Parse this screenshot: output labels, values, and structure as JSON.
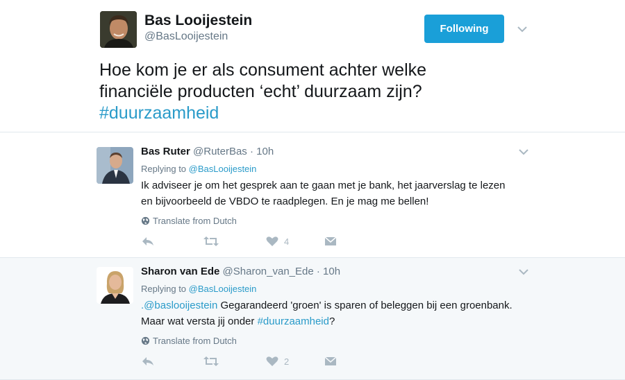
{
  "main_tweet": {
    "author_name": "Bas Looijestein",
    "author_handle": "@BasLooijestein",
    "follow_label": "Following",
    "text_line1": "Hoe kom je er als consument achter welke",
    "text_line2": "financiële producten ‘echt’ duurzaam zijn?",
    "hashtag": "#duurzaamheid"
  },
  "replies": [
    {
      "name": "Bas Ruter",
      "handle": "@RuterBas",
      "time": "· 10h",
      "replying_prefix": "Replying to ",
      "replying_to": "@BasLooijestein",
      "body_line1": "Ik adviseer je om het gesprek aan te gaan met je bank, het jaarverslag te lezen",
      "body_line2": "en bijvoorbeeld de VBDO te raadplegen. En je mag me bellen!",
      "translate": "Translate from Dutch",
      "likes": "4"
    },
    {
      "name": "Sharon van Ede",
      "handle": "@Sharon_van_Ede",
      "time": "· 10h",
      "replying_prefix": "Replying to ",
      "replying_to": "@BasLooijestein",
      "mention": ".@baslooijestein",
      "body_rest1": " Gegarandeerd 'groen' is sparen of beleggen bij een groenbank.",
      "body_line2_pre": "Maar wat versta jij onder ",
      "body_hashtag": "#duurzaamheid",
      "body_line2_post": "?",
      "translate": "Translate from Dutch",
      "likes": "2"
    }
  ],
  "icons": {
    "reply": "reply-arrow-icon",
    "retweet": "retweet-icon",
    "like": "heart-icon",
    "dm": "envelope-icon",
    "globe": "globe-icon",
    "chevron": "chevron-down-icon"
  },
  "colors": {
    "accent": "#1a9fd8",
    "link": "#2a9bc9",
    "secondary_text": "#657786",
    "action_icon": "#aab8c2",
    "reply_bg_alt": "#f5f8fa"
  }
}
